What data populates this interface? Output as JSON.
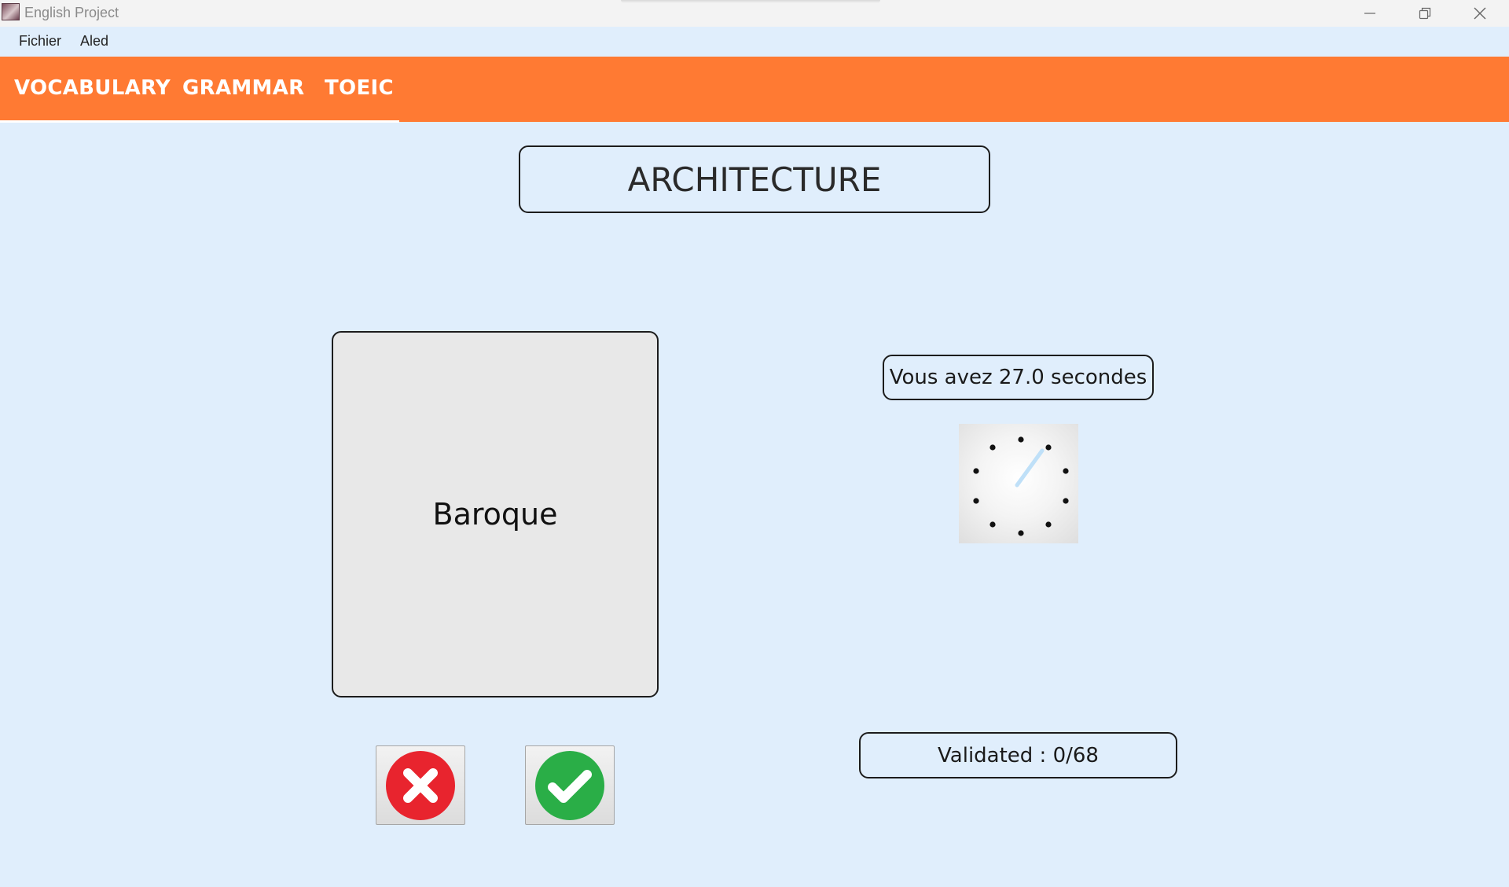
{
  "window": {
    "title": "English Project"
  },
  "menu": {
    "items": [
      "Fichier",
      "Aled"
    ]
  },
  "tabs": [
    {
      "label": "VOCABULARY",
      "active": true
    },
    {
      "label": "GRAMMAR",
      "active": false
    },
    {
      "label": "TOEIC",
      "active": false
    }
  ],
  "quiz": {
    "category": "ARCHITECTURE",
    "word": "Baroque",
    "timer_text": "Vous avez 27.0 secondes",
    "validated_text": "Validated : 0/68"
  },
  "colors": {
    "accent": "#ff7a33",
    "background": "#e0eefc",
    "wrong": "#e8242e",
    "right": "#2aae47",
    "clock_hand": "#bfe0f8"
  },
  "icons": {
    "wrong_button": "x-circle-icon",
    "right_button": "check-circle-icon",
    "minimize": "minimize-icon",
    "restore": "restore-icon",
    "close": "close-icon"
  }
}
